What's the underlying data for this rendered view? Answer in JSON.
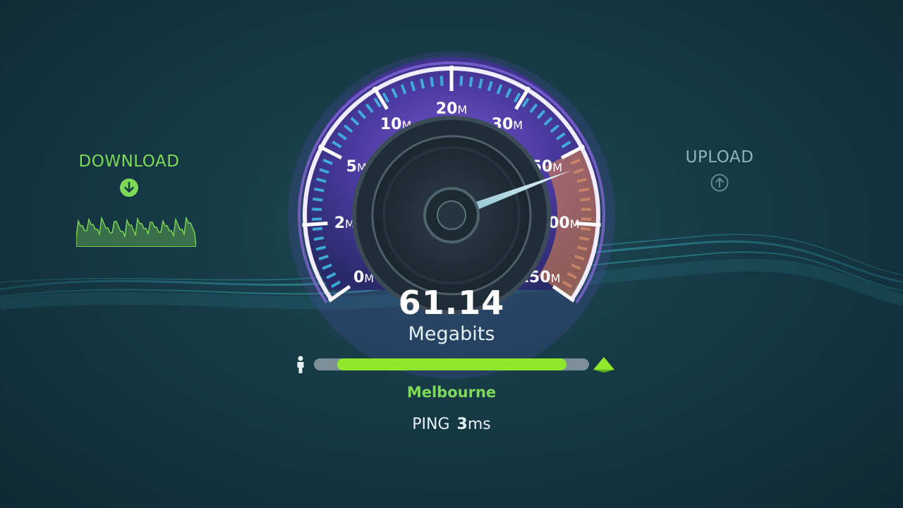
{
  "download": {
    "label": "DOWNLOAD",
    "icon": "download-arrow-icon",
    "color": "#7ed957"
  },
  "upload": {
    "label": "UPLOAD",
    "icon": "upload-arrow-icon",
    "color": "#8fb1bb"
  },
  "gauge": {
    "ticks": [
      {
        "num": "0",
        "suffix": "M"
      },
      {
        "num": "2",
        "suffix": "M"
      },
      {
        "num": "5",
        "suffix": "M"
      },
      {
        "num": "10",
        "suffix": "M"
      },
      {
        "num": "20",
        "suffix": "M"
      },
      {
        "num": "30",
        "suffix": "M"
      },
      {
        "num": "50",
        "suffix": "M"
      },
      {
        "num": "100",
        "suffix": "M"
      },
      {
        "num": "150",
        "suffix": "M"
      }
    ],
    "needle_value_mbps": 61.14,
    "colors": {
      "scale": "#3fb7e0",
      "highlight": "#e8894a",
      "rim": "#8a6be0"
    }
  },
  "speed": {
    "value": "61.14",
    "unit": "Megabits"
  },
  "progress": {
    "fraction": 0.91,
    "color": "#8fe82c"
  },
  "server": {
    "name": "Melbourne"
  },
  "ping": {
    "label": "PING",
    "value": "3",
    "unit": "ms"
  }
}
